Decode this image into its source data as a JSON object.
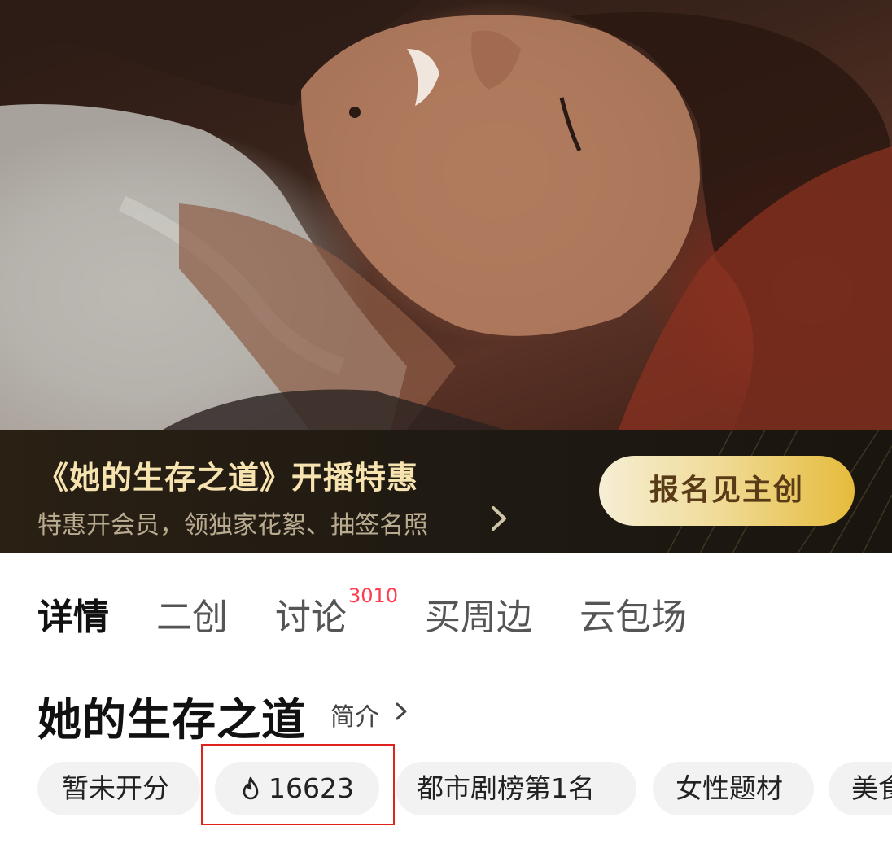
{
  "promo": {
    "title": "《她的生存之道》开播特惠",
    "subtitle": "特惠开会员，领独家花絮、抽签名照",
    "button_label": "报名见主创",
    "accent_colors": [
      "#f6e3b0",
      "#e6bb3c"
    ]
  },
  "tabs": [
    {
      "label": "详情",
      "active": true
    },
    {
      "label": "二创",
      "active": false
    },
    {
      "label": "讨论",
      "active": false,
      "badge": "3010"
    },
    {
      "label": "买周边",
      "active": false
    },
    {
      "label": "云包场",
      "active": false
    }
  ],
  "show": {
    "title": "她的生存之道",
    "intro_label": "简介"
  },
  "tags": [
    {
      "label": "暂未开分"
    },
    {
      "label": "16623",
      "icon": "flame-icon"
    },
    {
      "label": "都市剧榜第1名"
    },
    {
      "label": "女性题材"
    },
    {
      "label": "美食"
    }
  ],
  "colors": {
    "badge": "#ff3b4e",
    "highlight_box": "#e0221e"
  }
}
